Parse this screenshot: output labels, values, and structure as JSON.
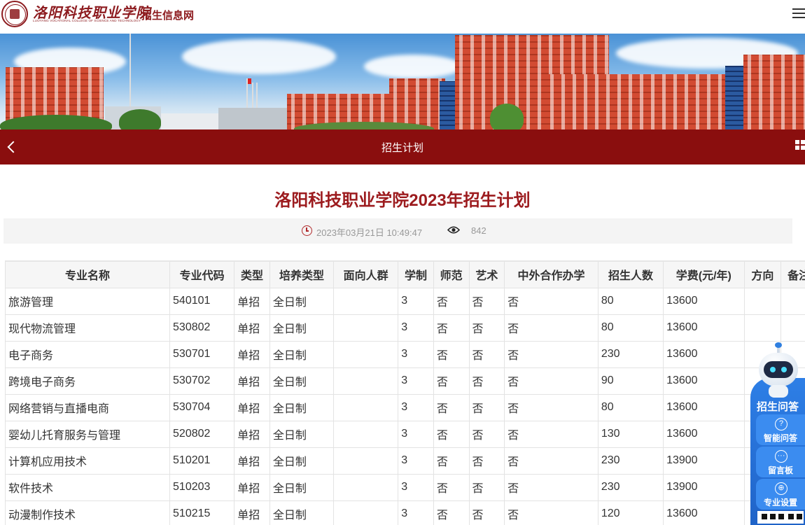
{
  "header": {
    "logo_cn": "洛阳科技职业学院",
    "logo_en": "LUOYANG VOCATIONAL COLLEGE OF SCIENCE AND TECHNOLOGY",
    "site_name": "招生信息网",
    "menu_icon": "hamburger-menu-icon"
  },
  "nav": {
    "title": "招生计划",
    "back_icon": "chevron-left-icon",
    "grid_icon": "grid-icon"
  },
  "article": {
    "title": "洛阳科技职业学院2023年招生计划",
    "date": "2023年03月21日 10:49:47",
    "views": "842"
  },
  "table": {
    "headers": [
      "专业名称",
      "专业代码",
      "类型",
      "培养类型",
      "面向人群",
      "学制",
      "师范",
      "艺术",
      "中外合作办学",
      "招生人数",
      "学费(元/年)",
      "方向",
      "备注"
    ],
    "rows": [
      [
        "旅游管理",
        "540101",
        "单招",
        "全日制",
        "",
        "3",
        "否",
        "否",
        "否",
        "80",
        "13600",
        "",
        ""
      ],
      [
        "现代物流管理",
        "530802",
        "单招",
        "全日制",
        "",
        "3",
        "否",
        "否",
        "否",
        "80",
        "13600",
        "",
        ""
      ],
      [
        "电子商务",
        "530701",
        "单招",
        "全日制",
        "",
        "3",
        "否",
        "否",
        "否",
        "230",
        "13600",
        "",
        ""
      ],
      [
        "跨境电子商务",
        "530702",
        "单招",
        "全日制",
        "",
        "3",
        "否",
        "否",
        "否",
        "90",
        "13600",
        "",
        ""
      ],
      [
        "网络营销与直播电商",
        "530704",
        "单招",
        "全日制",
        "",
        "3",
        "否",
        "否",
        "否",
        "80",
        "13600",
        "",
        ""
      ],
      [
        "婴幼儿托育服务与管理",
        "520802",
        "单招",
        "全日制",
        "",
        "3",
        "否",
        "否",
        "否",
        "130",
        "13600",
        "",
        ""
      ],
      [
        "计算机应用技术",
        "510201",
        "单招",
        "全日制",
        "",
        "3",
        "否",
        "否",
        "否",
        "230",
        "13900",
        "",
        ""
      ],
      [
        "软件技术",
        "510203",
        "单招",
        "全日制",
        "",
        "3",
        "否",
        "否",
        "否",
        "230",
        "13900",
        "",
        ""
      ],
      [
        "动漫制作技术",
        "510215",
        "单招",
        "全日制",
        "",
        "3",
        "否",
        "否",
        "否",
        "120",
        "13600",
        "",
        ""
      ]
    ]
  },
  "widget": {
    "title": "招生问答",
    "items": [
      {
        "label": "智能问答",
        "icon": "question-icon",
        "glyph": "?"
      },
      {
        "label": "留言板",
        "icon": "chat-icon",
        "glyph": "···"
      },
      {
        "label": "专业设置",
        "icon": "globe-icon",
        "glyph": "⊕"
      }
    ]
  },
  "colors": {
    "brand": "#8a0e0e",
    "title": "#9c1b1e",
    "widget": "#1f63c8"
  }
}
